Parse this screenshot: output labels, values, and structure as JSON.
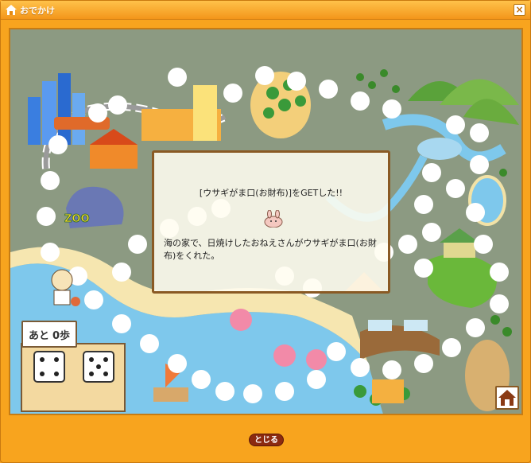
{
  "window": {
    "title": "おでかけ",
    "close_glyph": "×"
  },
  "board": {
    "steps_label": "あと",
    "steps_value": "0歩",
    "zoo_sign": "ZOO",
    "dice": [
      4,
      5
    ]
  },
  "dialog": {
    "heading": "[ウサギがま口(お財布)]をGETした!!",
    "message": "海の家で、日焼けしたおねえさんがウサギがま口(お財布)をくれた。",
    "item_icon": "rabbit-purse-icon"
  },
  "footer": {
    "close_label": "とじる"
  },
  "colors": {
    "frame": "#f8a41e",
    "board_ground": "#8c9a82",
    "sea": "#7ec8ec",
    "sand": "#f6e6b0",
    "dialog_border": "#8a5a24",
    "close_button": "#8c2a10"
  }
}
